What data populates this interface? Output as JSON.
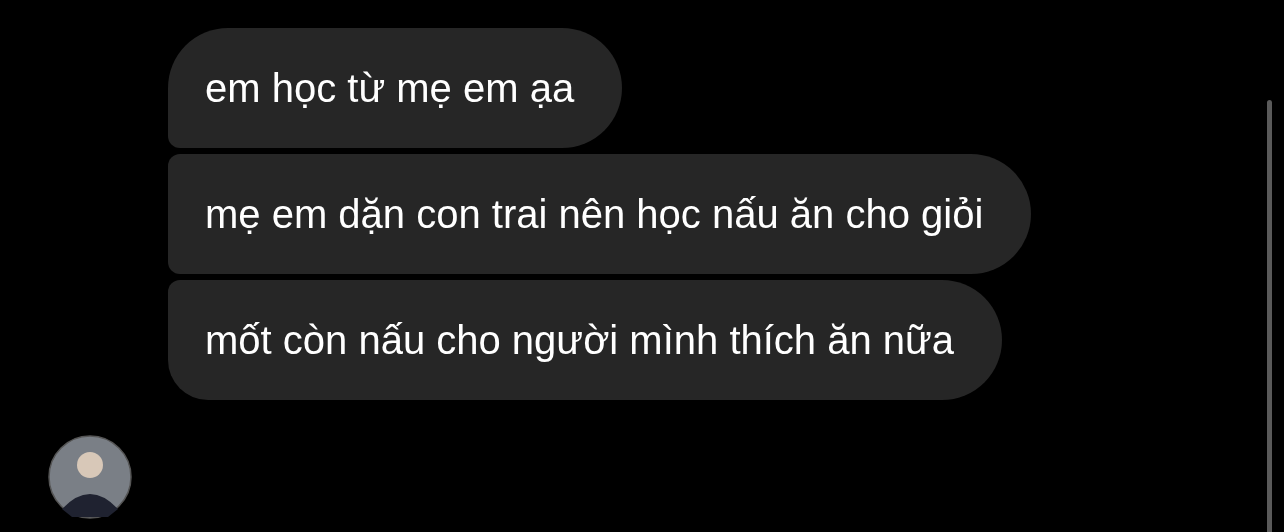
{
  "messages": [
    {
      "text": "em học từ mẹ em ạa"
    },
    {
      "text": "mẹ em dặn con trai nên học nấu ăn cho giỏi"
    },
    {
      "text": "mốt còn nấu cho người mình thích ăn nữa"
    }
  ]
}
